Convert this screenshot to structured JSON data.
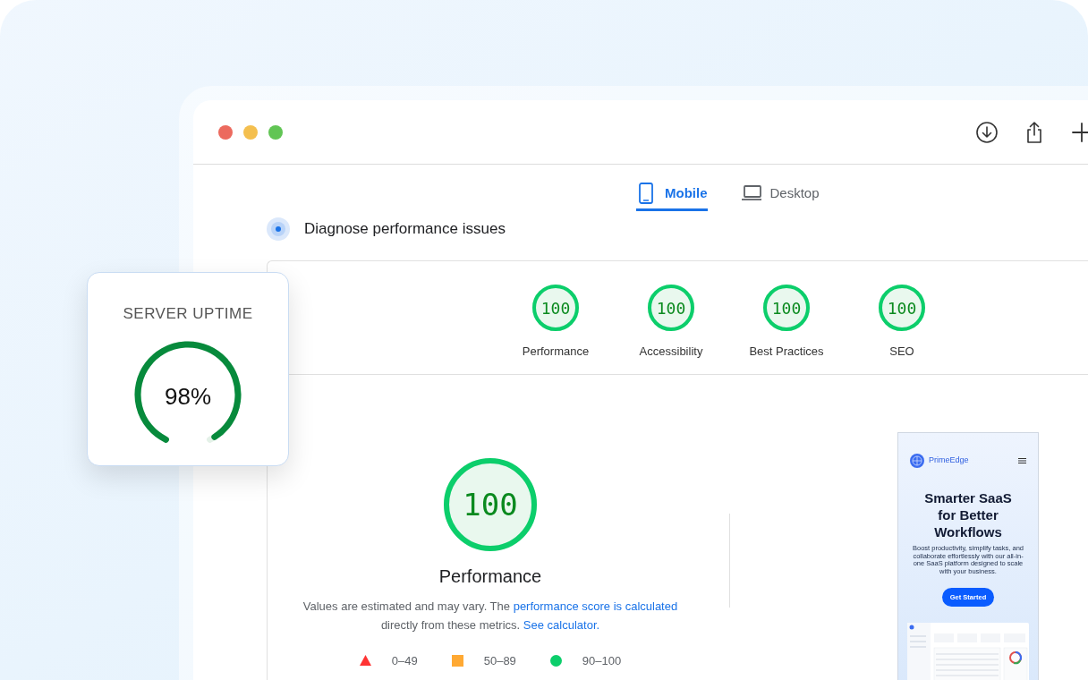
{
  "toolbar": {
    "buttons": [
      {
        "kind": "download"
      },
      {
        "kind": "share"
      },
      {
        "kind": "plus"
      }
    ]
  },
  "tabs": [
    {
      "label": "Mobile",
      "kind": "phone",
      "selected": true
    },
    {
      "label": "Desktop",
      "kind": "laptop",
      "selected": false
    }
  ],
  "heading": "Diagnose performance issues",
  "scores": [
    {
      "score": "100",
      "label": "Performance",
      "level": 1
    },
    {
      "score": "100",
      "label": "Accessibility",
      "level": 1
    },
    {
      "score": "100",
      "label": "Best Practices",
      "level": 1
    },
    {
      "score": "100",
      "label": "SEO",
      "level": 1
    }
  ],
  "main_score": {
    "score": "100",
    "label": "Performance",
    "level": 1
  },
  "description": [
    {
      "kind": "text",
      "text": "Values are estimated and may vary. The"
    },
    {
      "kind": "link",
      "text": "performance score is calculated"
    },
    {
      "kind": "text",
      "text": "directly from these metrics."
    },
    {
      "kind": "link",
      "text": "See calculator."
    }
  ],
  "legend": [
    {
      "kind": "triangle",
      "label": "0–49",
      "color": "#ff3333"
    },
    {
      "kind": "square",
      "label": "50–89",
      "color": "#ffa933"
    },
    {
      "kind": "circle",
      "label": "90–100",
      "color": "#0cce6b"
    }
  ],
  "preview": {
    "brand": "PrimeEdge",
    "title": "Smarter SaaS for Better Workflows",
    "text": "Boost productivity, simplify tasks, and collaborate effortlessly with our all-in-one SaaS platform designed to scale with your business.",
    "button": "Get Started"
  },
  "uptime_card": {
    "title": "SERVER UPTIME",
    "value": "98%",
    "level": 0.98
  }
}
